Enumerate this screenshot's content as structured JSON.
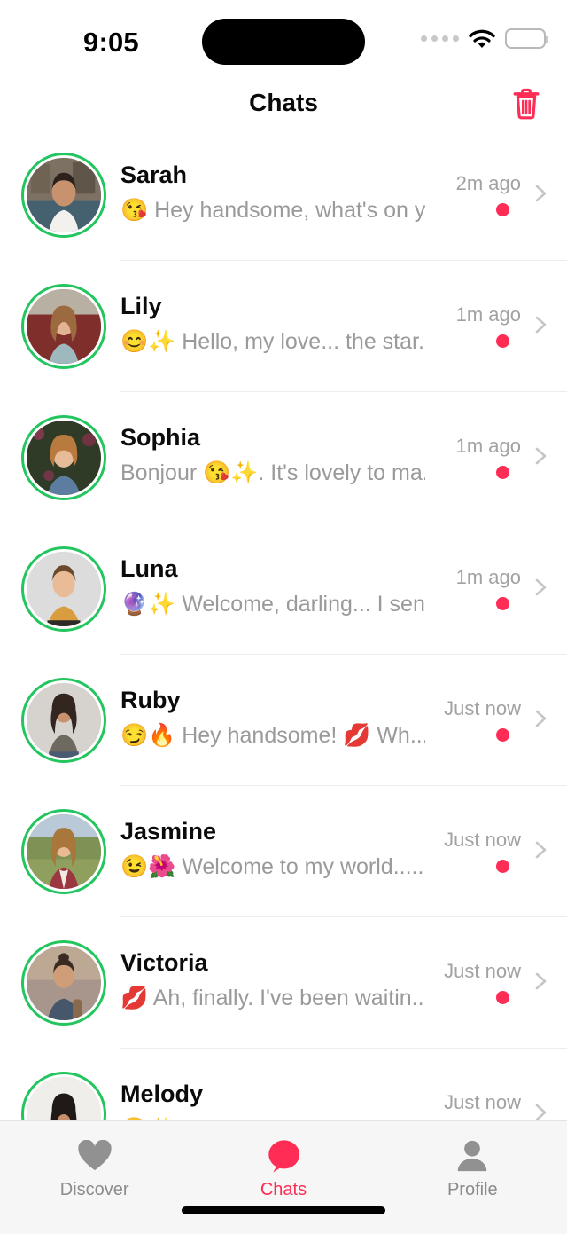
{
  "status_bar": {
    "time": "9:05",
    "cellular_icon": "cellular-dots-icon",
    "wifi_icon": "wifi-icon",
    "battery_icon": "battery-full-icon"
  },
  "nav": {
    "title": "Chats",
    "delete_icon": "trash-icon"
  },
  "colors": {
    "accent": "#ff2d55",
    "online_ring": "#22c55e",
    "muted_text": "#9a9a9a",
    "divider": "#ededed",
    "tabbar_bg": "#f6f6f6"
  },
  "chats": [
    {
      "name": "Sarah",
      "message": "😘 Hey handsome, what's on y...",
      "time": "2m ago",
      "unread": true
    },
    {
      "name": "Lily",
      "message": "😊✨ Hello, my love... the star...",
      "time": "1m ago",
      "unread": true
    },
    {
      "name": "Sophia",
      "message": "Bonjour 😘✨. It's lovely to ma...",
      "time": "1m ago",
      "unread": true
    },
    {
      "name": "Luna",
      "message": "🔮✨ Welcome, darling... I sen...",
      "time": "1m ago",
      "unread": true
    },
    {
      "name": "Ruby",
      "message": "😏🔥 Hey handsome! 💋 Wh...",
      "time": "Just now",
      "unread": true
    },
    {
      "name": "Jasmine",
      "message": "😉🌺 Welcome to my world......",
      "time": "Just now",
      "unread": true
    },
    {
      "name": "Victoria",
      "message": "💋 Ah, finally. I've been waitin...",
      "time": "Just now",
      "unread": true
    },
    {
      "name": "Melody",
      "message": "😊✨ ...",
      "time": "Just now",
      "unread": true
    }
  ],
  "tabs": [
    {
      "label": "Discover",
      "icon": "heart-icon",
      "active": false
    },
    {
      "label": "Chats",
      "icon": "speech-bubble-icon",
      "active": true
    },
    {
      "label": "Profile",
      "icon": "person-icon",
      "active": false
    }
  ]
}
